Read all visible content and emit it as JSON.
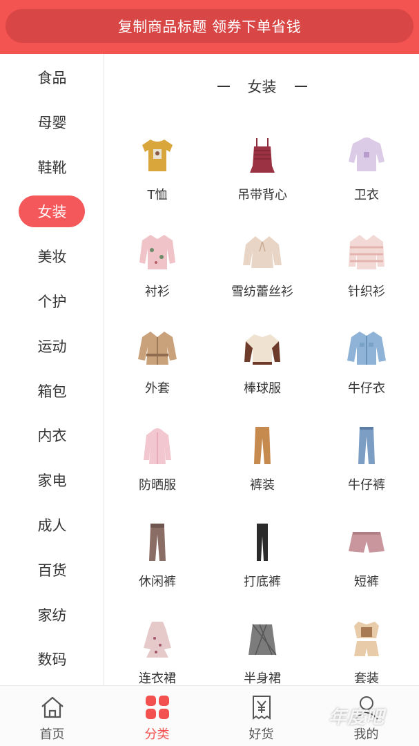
{
  "banner": {
    "text": "复制商品标题 领券下单省钱"
  },
  "sidebar": {
    "active_index": 3,
    "items": [
      {
        "label": "食品"
      },
      {
        "label": "母婴"
      },
      {
        "label": "鞋靴"
      },
      {
        "label": "女装"
      },
      {
        "label": "美妆"
      },
      {
        "label": "个护"
      },
      {
        "label": "运动"
      },
      {
        "label": "箱包"
      },
      {
        "label": "内衣"
      },
      {
        "label": "家电"
      },
      {
        "label": "成人"
      },
      {
        "label": "百货"
      },
      {
        "label": "家纺"
      },
      {
        "label": "数码"
      }
    ]
  },
  "section": {
    "title": "女装"
  },
  "categories": [
    {
      "label": "T恤",
      "icon": "t-shirt-icon"
    },
    {
      "label": "吊带背心",
      "icon": "camisole-icon"
    },
    {
      "label": "卫衣",
      "icon": "hoodie-icon"
    },
    {
      "label": "衬衫",
      "icon": "shirt-icon"
    },
    {
      "label": "雪纺蕾丝衫",
      "icon": "chiffon-blouse-icon"
    },
    {
      "label": "针织衫",
      "icon": "knit-sweater-icon"
    },
    {
      "label": "外套",
      "icon": "coat-icon"
    },
    {
      "label": "棒球服",
      "icon": "baseball-jacket-icon"
    },
    {
      "label": "牛仔衣",
      "icon": "denim-jacket-icon"
    },
    {
      "label": "防晒服",
      "icon": "sun-protection-coat-icon"
    },
    {
      "label": "裤装",
      "icon": "trousers-icon"
    },
    {
      "label": "牛仔裤",
      "icon": "jeans-icon"
    },
    {
      "label": "休闲裤",
      "icon": "casual-pants-icon"
    },
    {
      "label": "打底裤",
      "icon": "leggings-icon"
    },
    {
      "label": "短裤",
      "icon": "shorts-icon"
    },
    {
      "label": "连衣裙",
      "icon": "dress-icon"
    },
    {
      "label": "半身裙",
      "icon": "skirt-icon"
    },
    {
      "label": "套装",
      "icon": "outfit-set-icon"
    }
  ],
  "tabbar": {
    "active_index": 1,
    "tabs": [
      {
        "label": "首页",
        "icon": "home-icon"
      },
      {
        "label": "分类",
        "icon": "category-icon"
      },
      {
        "label": "好货",
        "icon": "voucher-icon"
      },
      {
        "label": "我的",
        "icon": "profile-icon"
      }
    ]
  },
  "watermark": {
    "text": "年度吧"
  },
  "colors": {
    "accent": "#f45451",
    "banner_pill": "#d94646",
    "active_pill": "#f5585a"
  }
}
